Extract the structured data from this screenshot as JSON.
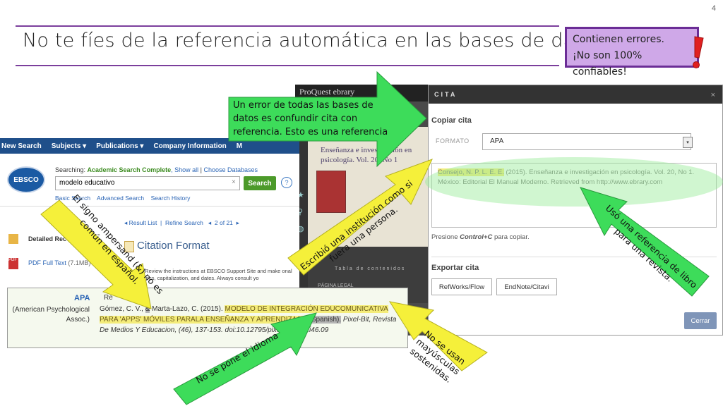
{
  "slide": {
    "number": "4",
    "title": "No te fíes de la referencia automática en las bases de datos",
    "warning": {
      "line1": "Contienen errores.",
      "line2": "¡No son 100% confiables!"
    },
    "colors": {
      "accent": "#7b3f9c",
      "green_arrow": "#3ddc5a",
      "yellow_arrow": "#f5f03a",
      "warning_box": "#cfa8e8",
      "exclaim": "#e02020"
    }
  },
  "annotations": {
    "top_green": "Un error de todas las bases de datos es confundir cita con referencia. Esto es una referencia",
    "ampersand": "El signo ampersand (&) no es común en español.",
    "institution": "Escribió una institución como si fuera una persona.",
    "book_ref": "Usó una referencia de libro para una revista.",
    "uppercase": "No se usan mayúsculas sostenidas.",
    "language": "No se pone el idioma"
  },
  "ebsco": {
    "nav": [
      "New Search",
      "Subjects ▾",
      "Publications ▾",
      "Company Information",
      "M"
    ],
    "logo": "EBSCO",
    "searching_prefix": "Searching: ",
    "database": "Academic Search Complete",
    "show_all": ", Show all",
    "choose_db": "Choose Databases",
    "query": "modelo educativo",
    "search_btn": "Search",
    "help": "?",
    "links": "Basic Search    Advanced Search    Search History",
    "detailed": "Detailed Rec",
    "pdf": "PDF Full Text",
    "pdf_size": "(7.1MB)",
    "result_nav": "◂ Result List  |  Refine Search   ◂  2 of 21  ▸",
    "citation_format": "Citation Format",
    "review": "E: Review the instructions at EBSCO Support Site and make onal names, capitalization, and dates. Always consult yo",
    "apa": "APA",
    "apa_sub": "(American Psychological Assoc.)",
    "ref_prefix": "Re",
    "ref_authors": "Gómez, C. V., ",
    "ref_amp": "&",
    "ref_author2": " Marta-Lazo, C. (2015). ",
    "ref_title_upper": "MODELO DE INTEGRACIÓN EDUCOMUNICATIVA PARA 'APPS' MÓVILES PARALA ENSEÑANZA Y APRENDIZAJE.",
    "ref_lang": "(Spanish).",
    "ref_tail": " Pixel-Bit, Revista De Medios Y Educacion, (46), 137-153. doi:10.12795/pixelbit.2015.i46.09"
  },
  "proquest": {
    "header": "ProQuest ebrary",
    "book_title": "Enseñanza e investigación en psicología. Vol. 20, No 1",
    "toc": "Tabla de contenidos",
    "legal": "PÁGINA LEGAL"
  },
  "modal": {
    "header": "CITA",
    "close": "×",
    "copy_title": "Copiar cita",
    "format_label": "FORMATO",
    "format_value": "APA",
    "citation_author": "Consejo, N. P. L. E. E.",
    "citation_rest": " (2015). Enseñanza e investigación en psicología. Vol. 20, No 1. México: Editorial El Manual Moderno. Retrieved from http://www.ebrary.com",
    "presione_prefix": "Presione ",
    "presione_key": "Control+C",
    "presione_suffix": " para copiar.",
    "export_title": "Exportar cita",
    "btn_refworks": "RefWorks/Flow",
    "btn_endnote": "EndNote/Citavi",
    "btn_close": "Cerrar"
  }
}
